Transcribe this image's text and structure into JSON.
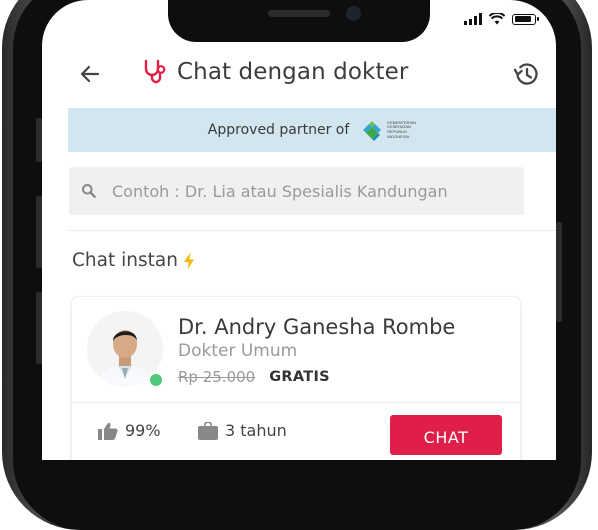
{
  "status_bar": {
    "battery_level": 0.9
  },
  "header": {
    "title": "Chat dengan dokter",
    "back_icon": "arrow-left-icon",
    "title_icon": "stethoscope-icon",
    "history_icon": "history-icon",
    "accent_color": "#e01e4a"
  },
  "partner": {
    "text": "Approved partner of",
    "logo_lines": [
      "KEMENTERIAN",
      "KESEHATAN",
      "REPUBLIK",
      "INDONESIA"
    ]
  },
  "search": {
    "placeholder": "Contoh : Dr. Lia atau Spesialis Kandungan",
    "value": ""
  },
  "section": {
    "title": "Chat instan",
    "icon": "lightning-icon",
    "icon_color": "#f5b800"
  },
  "doctor": {
    "name": "Dr. Andry Ganesha Rombe",
    "specialty": "Dokter Umum",
    "old_price": "Rp 25.000",
    "price": "GRATIS",
    "online": true,
    "online_color": "#4cca7a",
    "rating": "99%",
    "experience": "3 tahun",
    "chat_button": "CHAT"
  }
}
